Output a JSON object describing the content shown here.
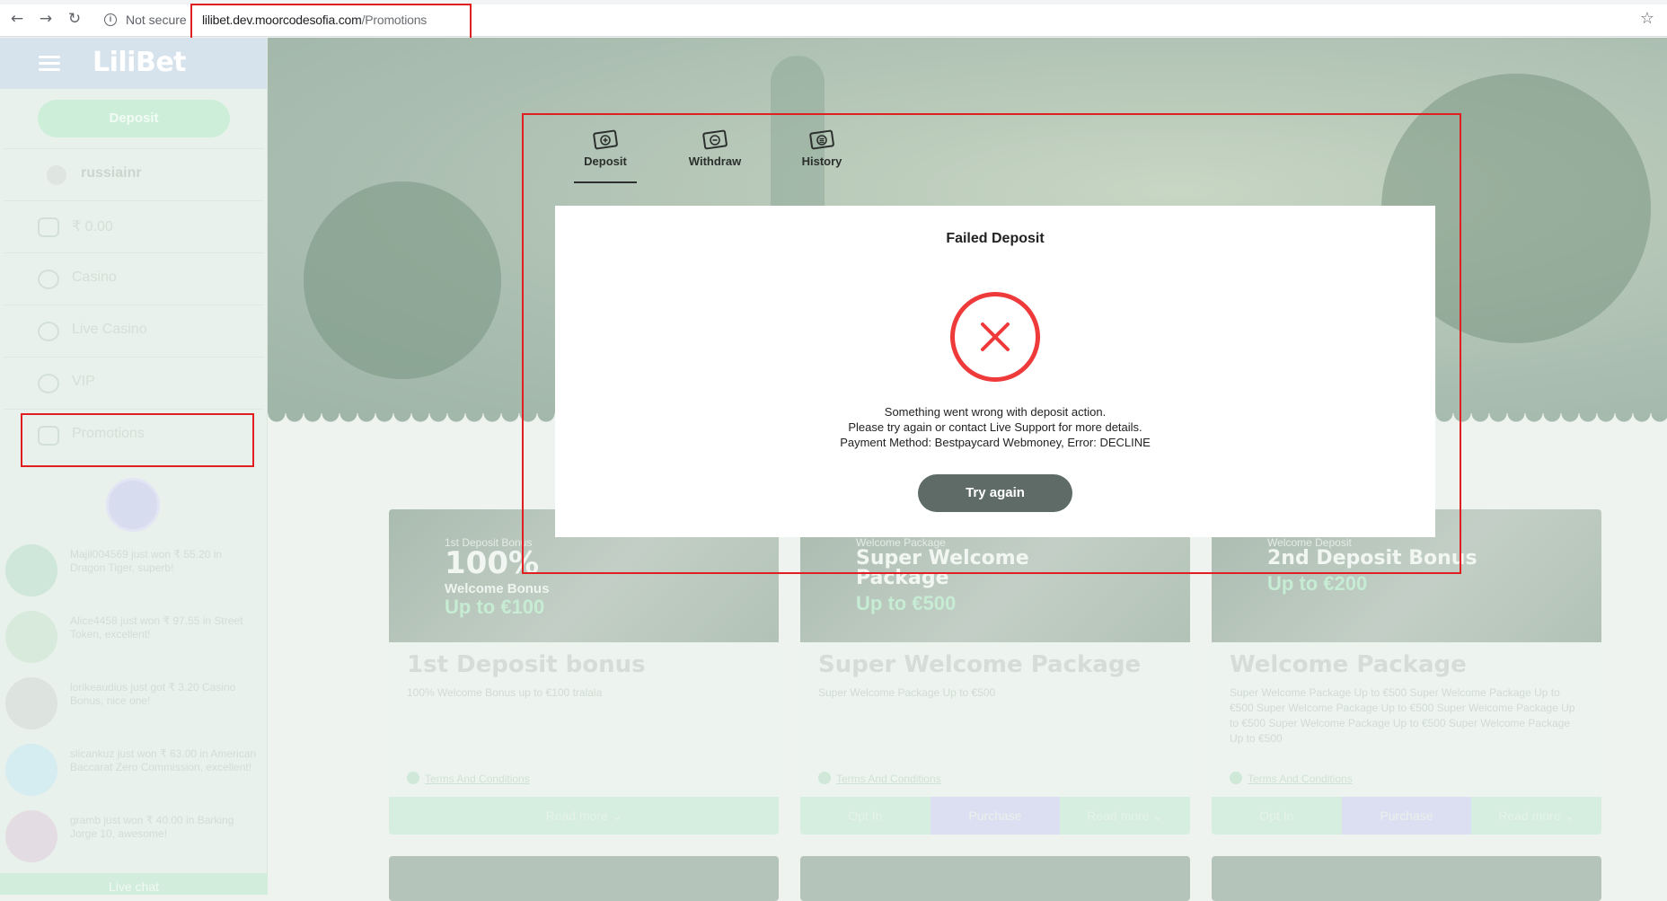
{
  "browser": {
    "security_label": "Not secure",
    "url_host": "lilibet.dev.moorcodesofia.com",
    "url_path": "/Promotions"
  },
  "sidebar": {
    "logo": "LiliBet",
    "deposit_label": "Deposit",
    "username": "russiainr",
    "balance": "₹ 0.00",
    "items": [
      {
        "label": "Casino",
        "icon": "casino-icon"
      },
      {
        "label": "Live Casino",
        "icon": "live-casino-icon"
      },
      {
        "label": "VIP",
        "icon": "vip-icon"
      },
      {
        "label": "Promotions",
        "icon": "gift-icon"
      }
    ],
    "feed": [
      {
        "text": "Majil004569 just won ₹ 55.20 in Dragon Tiger, superb!",
        "color": "#cfe6da"
      },
      {
        "text": "Alice4458 just won ₹ 97.55 in Street Token, excellent!",
        "color": "#d7eadb"
      },
      {
        "text": "lorikeaudius just got ₹ 3.20 Casino Bonus, nice one!",
        "color": "#dde3df"
      },
      {
        "text": "slicankuz just won ₹ 63.00 in American Baccarat Zero Commission, excellent!",
        "color": "#d5ecf1"
      },
      {
        "text": "gramb just won ₹ 40.00 in Barking Jorge 10, awesome!",
        "color": "#e3dce2"
      }
    ],
    "live_chat": "Live chat"
  },
  "cards": [
    {
      "banner_small": "1st Deposit Bonus",
      "banner_big": "100%",
      "banner_sub": "Welcome Bonus",
      "banner_accent": "Up to €100",
      "title": "1st Deposit bonus",
      "desc": "100% Welcome Bonus up to €100 tralala",
      "terms": "Terms And Conditions",
      "actions": [
        {
          "label": "Read more ⌄",
          "style": "green"
        }
      ]
    },
    {
      "banner_small": "Welcome Package",
      "banner_big": "Super Welcome Package",
      "banner_sub": "",
      "banner_accent": "Up to €500",
      "title": "Super Welcome Package",
      "desc": "Super Welcome Package Up to €500",
      "terms": "Terms And Conditions",
      "actions": [
        {
          "label": "Opt In",
          "style": "green"
        },
        {
          "label": "Purchase",
          "style": "blue"
        },
        {
          "label": "Read more ⌄",
          "style": "green"
        }
      ]
    },
    {
      "banner_small": "Welcome Deposit",
      "banner_big": "2nd Deposit Bonus",
      "banner_sub": "",
      "banner_accent": "Up to €200",
      "title": "Welcome Package",
      "desc": "Super Welcome Package Up to €500 Super Welcome Package Up to €500 Super Welcome Package Up to €500 Super Welcome Package Up to €500 Super Welcome Package Up to €500 Super Welcome Package Up to €500",
      "terms": "Terms And Conditions",
      "actions": [
        {
          "label": "Opt In",
          "style": "green"
        },
        {
          "label": "Purchase",
          "style": "blue"
        },
        {
          "label": "Read more ⌄",
          "style": "green"
        }
      ]
    }
  ],
  "modal": {
    "tabs": [
      {
        "label": "Deposit",
        "icon": "deposit-icon",
        "active": true
      },
      {
        "label": "Withdraw",
        "icon": "withdraw-icon",
        "active": false
      },
      {
        "label": "History",
        "icon": "history-icon",
        "active": false
      }
    ],
    "title": "Failed Deposit",
    "status_icon": "error-x-icon",
    "status_color": "#ee3a3a",
    "message_lines": [
      "Something went wrong with deposit action.",
      "Please try again or contact Live Support for more details.",
      "Payment Method: Bestpaycard Webmoney, Error: DECLINE"
    ],
    "try_again_label": "Try again"
  },
  "colors": {
    "highlight": "#e02020",
    "button_dark": "#5e6b67",
    "deposit_green": "#cdeed8"
  }
}
